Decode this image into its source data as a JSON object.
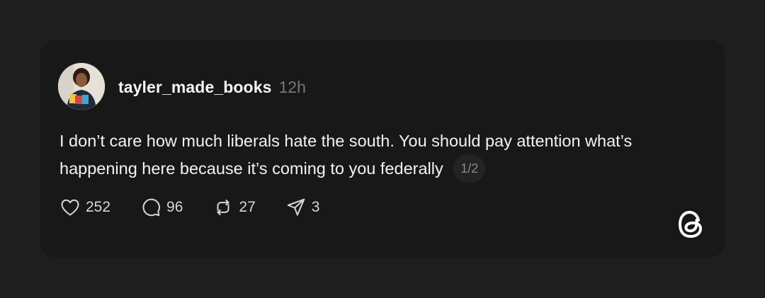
{
  "post": {
    "username": "tayler_made_books",
    "time": "12h",
    "text": "I don’t care how much liberals hate the south. You should pay attention what’s happening here because it’s coming to you federally",
    "thread_position": "1/2"
  },
  "actions": {
    "likes": "252",
    "replies": "96",
    "reposts": "27",
    "shares": "3"
  },
  "icons": [
    "heart-icon",
    "comment-icon",
    "repost-icon",
    "share-icon",
    "threads-logo-icon"
  ],
  "colors": {
    "background": "#1e1e1e",
    "card": "#181818",
    "muted": "#777777"
  }
}
